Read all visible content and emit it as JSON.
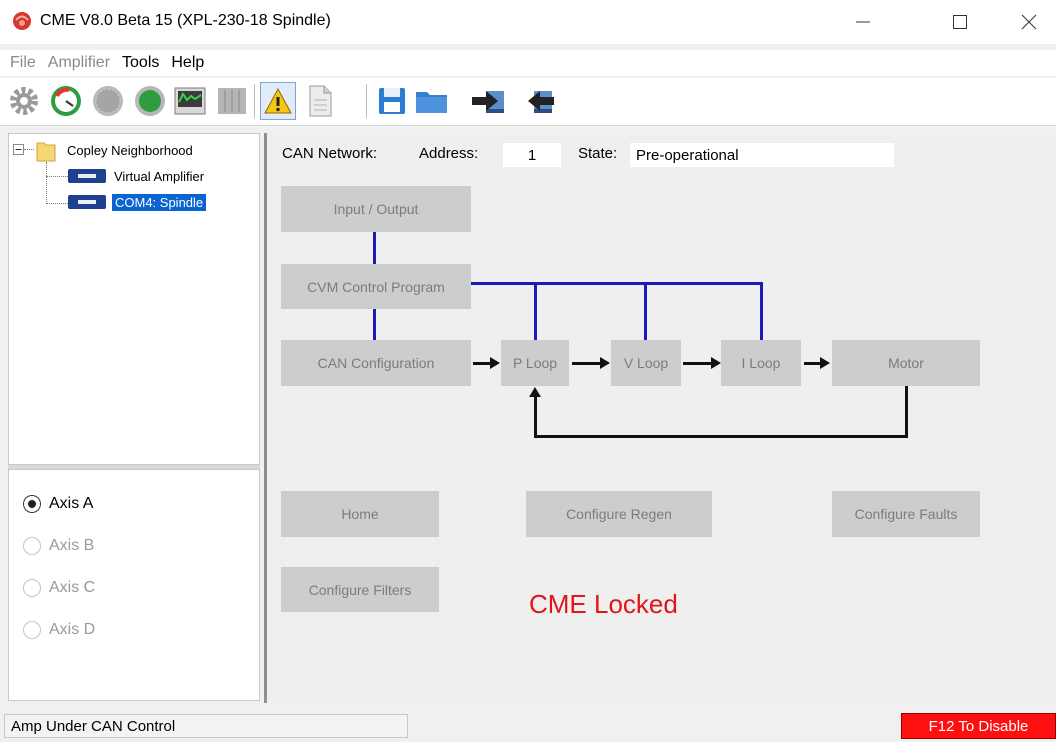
{
  "window": {
    "title": "CME V8.0 Beta 15 (XPL-230-18 Spindle)",
    "minimize_glyph": "—",
    "maximize_glyph": "☐",
    "close_glyph": "✕"
  },
  "menu": {
    "items": [
      {
        "label": "File",
        "enabled": false
      },
      {
        "label": "Amplifier",
        "enabled": false
      },
      {
        "label": "Tools",
        "enabled": true
      },
      {
        "label": "Help",
        "enabled": true
      }
    ]
  },
  "toolbar": {
    "icons": [
      "gear-icon",
      "gauge-icon",
      "dial-icon",
      "green-circle-icon",
      "scope-icon",
      "graph-icon",
      "warning-icon",
      "document-icon",
      "save-icon",
      "folder-icon",
      "download-arrow-icon",
      "upload-arrow-icon"
    ]
  },
  "tree": {
    "root_label": "Copley Neighborhood",
    "children": [
      {
        "label": "Virtual Amplifier",
        "selected": false
      },
      {
        "label": "COM4: Spindle",
        "selected": true
      }
    ]
  },
  "axes": [
    {
      "label": "Axis A",
      "checked": true,
      "enabled": true
    },
    {
      "label": "Axis B",
      "checked": false,
      "enabled": false
    },
    {
      "label": "Axis C",
      "checked": false,
      "enabled": false
    },
    {
      "label": "Axis D",
      "checked": false,
      "enabled": false
    }
  ],
  "network": {
    "can_label": "CAN Network:",
    "address_label": "Address:",
    "address_value": "1",
    "state_label": "State:",
    "state_value": "Pre-operational"
  },
  "diagram": {
    "input_output": "Input / Output",
    "cvm_program": "CVM Control Program",
    "can_config": "CAN Configuration",
    "p_loop": "P Loop",
    "v_loop": "V Loop",
    "i_loop": "I Loop",
    "motor": "Motor",
    "colors": {
      "control_lines": "#1b1bb8",
      "signal_lines": "#111111",
      "block_fill": "#cdcdcd"
    }
  },
  "actions": {
    "home": "Home",
    "configure_regen": "Configure Regen",
    "configure_faults": "Configure Faults",
    "configure_filters": "Configure Filters"
  },
  "lock_message": "CME Locked",
  "status": {
    "left": "Amp Under CAN Control",
    "right": "F12 To Disable",
    "right_color": "#ff1010"
  }
}
